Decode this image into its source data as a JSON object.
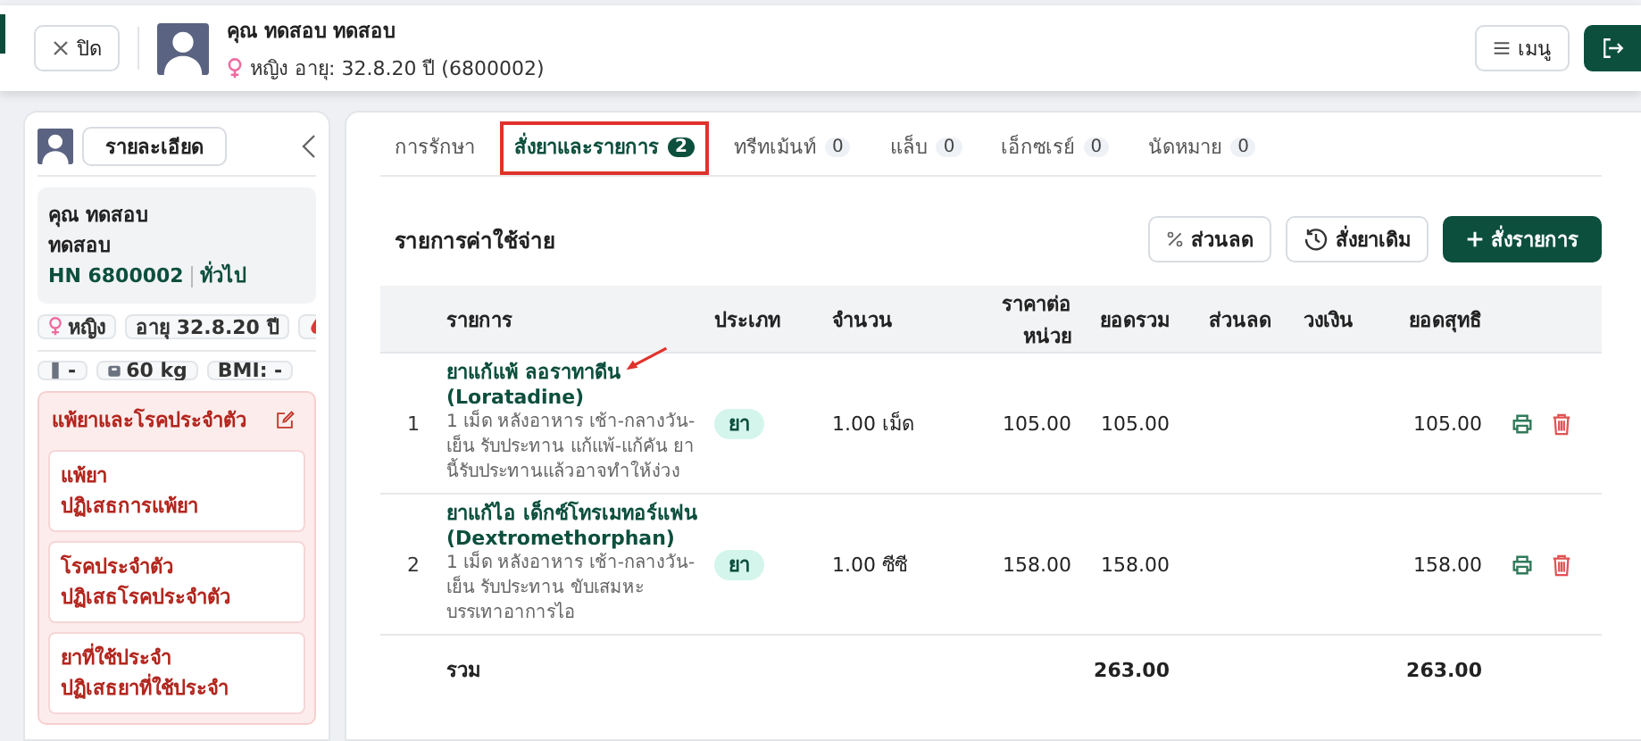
{
  "header": {
    "close_button": "ปิด",
    "patient_name": "คุณ ทดสอบ ทดสอบ",
    "gender": "หญิง",
    "age_line": "อายุ: 32.8.20 ปี (6800002)",
    "menu_button": "เมนู"
  },
  "sidebar": {
    "details_button": "รายละเอียด",
    "name_lines": [
      "คุณ ทดสอบ",
      "ทดสอบ"
    ],
    "hn": "HN 6800002",
    "category": "ทั่วไป",
    "chips": [
      {
        "kind": "gender",
        "text": "หญิง"
      },
      {
        "kind": "text",
        "text": "อายุ 32.8.20 ปี"
      },
      {
        "kind": "blood"
      }
    ],
    "vitals": [
      {
        "kind": "height",
        "text": "-"
      },
      {
        "kind": "weight",
        "text": "60 kg"
      },
      {
        "kind": "text",
        "text": "BMI: -"
      }
    ],
    "allergy_title": "แพ้ยาและโรคประจำตัว",
    "allergy_cards": [
      {
        "title": "แพ้ยา",
        "value": "ปฏิเสธการแพ้ยา"
      },
      {
        "title": "โรคประจำตัว",
        "value": "ปฏิเสธโรคประจำตัว"
      },
      {
        "title": "ยาที่ใช้ประจำ",
        "value": "ปฏิเสธยาที่ใช้ประจำ"
      }
    ]
  },
  "tabs": [
    {
      "label": "การรักษา",
      "selected": false
    },
    {
      "label": "สั่งยาและรายการ",
      "count": "2",
      "selected": true
    },
    {
      "label": "ทรีทเม้นท์",
      "count": "0",
      "selected": false
    },
    {
      "label": "แล็บ",
      "count": "0",
      "selected": false
    },
    {
      "label": "เอ็กซเรย์",
      "count": "0",
      "selected": false
    },
    {
      "label": "นัดหมาย",
      "count": "0",
      "selected": false
    }
  ],
  "section_title": "รายการค่าใช้จ่าย",
  "actions": [
    {
      "kind": "discount",
      "label": "ส่วนลด"
    },
    {
      "kind": "history",
      "label": "สั่งยาเดิม"
    },
    {
      "kind": "add",
      "label": "สั่งรายการ"
    }
  ],
  "table": {
    "columns": [
      "รายการ",
      "ประเภท",
      "จำนวน",
      "ราคาต่อหน่วย",
      "ยอดรวม",
      "ส่วนลด",
      "วงเงิน",
      "ยอดสุทธิ"
    ],
    "rows": [
      {
        "no": "1",
        "name": "ยาแก้แพ้ ลอราทาดีน",
        "generic": "(Loratadine)",
        "instructions": "1 เม็ด หลังอาหาร เช้า-กลางวัน-เย็น รับประทาน แก้แพ้-แก้คัน ยานี้รับประทานแล้วอาจทำให้ง่วง",
        "type": "ยา",
        "qty": "1.00 เม็ด",
        "unit_price": "105.00",
        "total": "105.00",
        "net": "105.00"
      },
      {
        "no": "2",
        "name": "ยาแก้ไอ เด็กซ์โทรเมทอร์แฟน",
        "generic": "(Dextromethorphan)",
        "instructions": "1 เม็ด หลังอาหาร เช้า-กลางวัน-เย็น รับประทาน ขับเสมหะ บรรเทาอาการไอ",
        "type": "ยา",
        "qty": "1.00 ซีซี",
        "unit_price": "158.00",
        "total": "158.00",
        "net": "158.00"
      }
    ],
    "total_row": {
      "label": "รวม",
      "total": "263.00",
      "net": "263.00"
    }
  }
}
